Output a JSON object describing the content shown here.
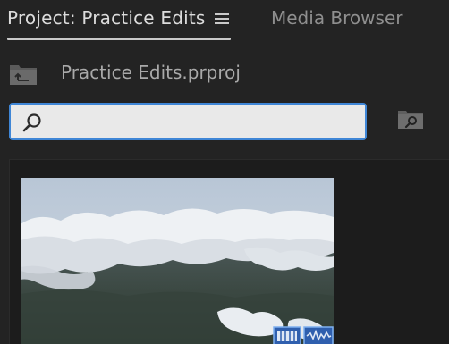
{
  "tabs": {
    "project_label": "Project: Practice Edits",
    "media_label": "Media Browser"
  },
  "path": {
    "label": "Practice Edits.prproj"
  },
  "search": {
    "value": "",
    "placeholder": ""
  },
  "colors": {
    "background": "#232323",
    "accent": "#3f86d6",
    "active_tab_text": "#dcdcdc",
    "inactive_tab_text": "#8f8f8f"
  },
  "icons": {
    "panel_menu": "hamburger-menu-icon",
    "up_folder": "folder-up-icon",
    "search": "search-icon",
    "find_in_bin": "folder-search-icon",
    "clip_video": "video-track-icon",
    "clip_audio": "audio-track-icon"
  },
  "clip": {
    "thumbnail": "aerial-clouds-over-landscape",
    "has_video": true,
    "has_audio": true
  }
}
